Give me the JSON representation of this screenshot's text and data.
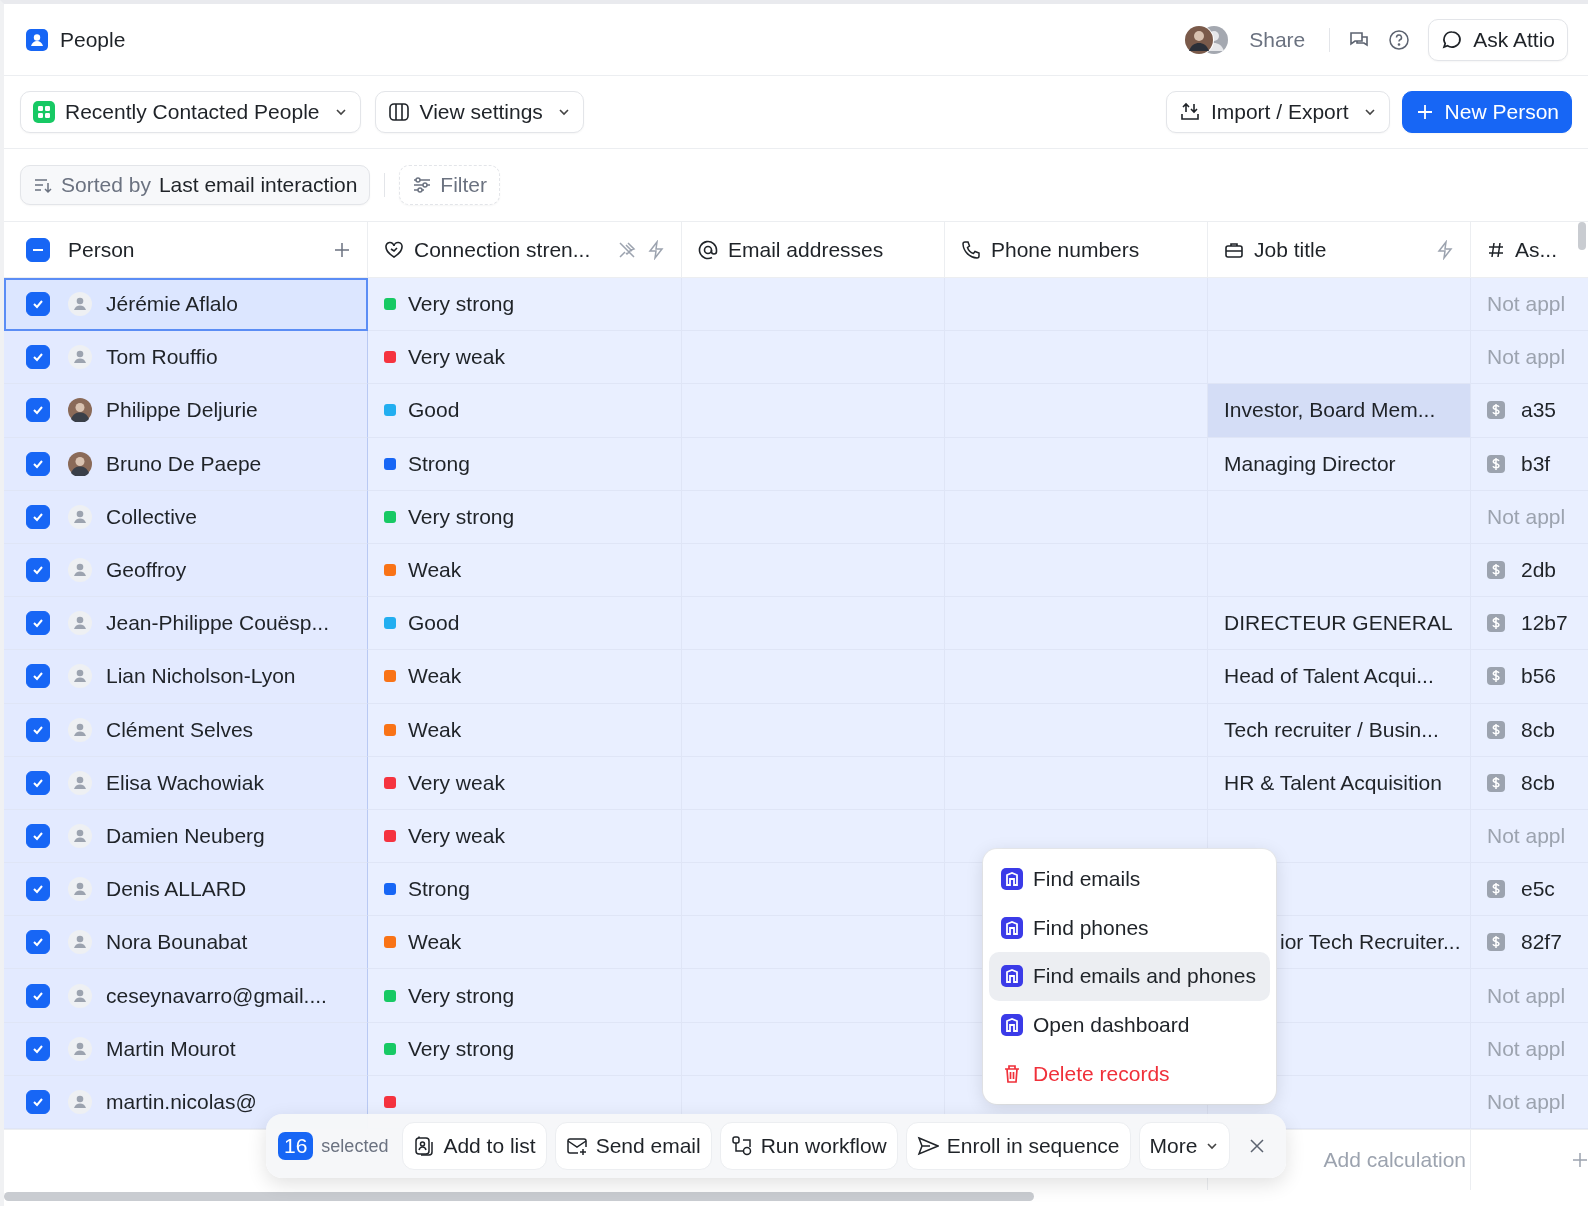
{
  "header": {
    "title": "People",
    "share": "Share",
    "ask": "Ask Attio"
  },
  "toolbar": {
    "view": "Recently Contacted People",
    "view_settings": "View settings",
    "import_export": "Import / Export",
    "new": "New Person"
  },
  "sort": {
    "label": "Sorted by",
    "value": "Last email interaction",
    "filter": "Filter"
  },
  "table": {
    "select_all": {
      "indeterminate": true
    },
    "columns": [
      {
        "label": "Person"
      },
      {
        "label": "Connection stren..."
      },
      {
        "label": "Email addresses"
      },
      {
        "label": "Phone numbers"
      },
      {
        "label": "Job title"
      },
      {
        "label": "As..."
      }
    ],
    "rows": [
      {
        "name": "Jérémie Aflalo",
        "photo": false,
        "checked": true,
        "focused": true,
        "strength": "Very strong",
        "color": "#17c964",
        "job_hover": false,
        "last": {
          "kind": "none",
          "text": "Not appl"
        }
      },
      {
        "name": "Tom Rouffio",
        "photo": false,
        "checked": true,
        "focused": false,
        "strength": "Very weak",
        "color": "#f5333f",
        "job_hover": false,
        "last": {
          "kind": "none",
          "text": "Not appl"
        }
      },
      {
        "name": "Philippe Deljurie",
        "photo": true,
        "checked": true,
        "focused": false,
        "strength": "Good",
        "color": "#22aef0",
        "job": "Investor, Board Mem...",
        "job_hover": true,
        "last": {
          "kind": "id",
          "text": "a35"
        }
      },
      {
        "name": "Bruno De Paepe",
        "photo": true,
        "checked": true,
        "focused": false,
        "strength": "Strong",
        "color": "#1766f5",
        "job": "Managing Director",
        "job_hover": false,
        "last": {
          "kind": "id",
          "text": "b3f"
        }
      },
      {
        "name": "Collective",
        "photo": false,
        "checked": true,
        "focused": false,
        "strength": "Very strong",
        "color": "#17c964",
        "job_hover": false,
        "last": {
          "kind": "none",
          "text": "Not appl"
        }
      },
      {
        "name": "Geoffroy",
        "photo": false,
        "checked": true,
        "focused": false,
        "strength": "Weak",
        "color": "#f97316",
        "job_hover": false,
        "last": {
          "kind": "id",
          "text": "2db"
        }
      },
      {
        "name": "Jean-Philippe Couësp...",
        "photo": false,
        "checked": true,
        "focused": false,
        "strength": "Good",
        "color": "#22aef0",
        "job": "DIRECTEUR GENERAL",
        "job_hover": false,
        "last": {
          "kind": "id",
          "text": "12b7"
        }
      },
      {
        "name": "Lian Nicholson-Lyon",
        "photo": false,
        "checked": true,
        "focused": false,
        "strength": "Weak",
        "color": "#f97316",
        "job": "Head of Talent Acqui...",
        "job_hover": false,
        "last": {
          "kind": "id",
          "text": "b56"
        }
      },
      {
        "name": "Clément Selves",
        "photo": false,
        "checked": true,
        "focused": false,
        "strength": "Weak",
        "color": "#f97316",
        "job": "Tech recruiter / Busin...",
        "job_hover": false,
        "last": {
          "kind": "id",
          "text": "8cb"
        }
      },
      {
        "name": "Elisa Wachowiak",
        "photo": false,
        "checked": true,
        "focused": false,
        "strength": "Very weak",
        "color": "#f5333f",
        "job": "HR & Talent Acquisition",
        "job_hover": false,
        "last": {
          "kind": "id",
          "text": "8cb"
        }
      },
      {
        "name": "Damien Neuberg",
        "photo": false,
        "checked": true,
        "focused": false,
        "strength": "Very weak",
        "color": "#f5333f",
        "job_hover": false,
        "last": {
          "kind": "none",
          "text": "Not appl"
        }
      },
      {
        "name": "Denis ALLARD",
        "photo": false,
        "checked": true,
        "focused": false,
        "strength": "Strong",
        "color": "#1766f5",
        "job_hover": false,
        "last": {
          "kind": "id",
          "text": "e5c"
        }
      },
      {
        "name": "Nora Bounabat",
        "photo": false,
        "checked": true,
        "focused": false,
        "strength": "Weak",
        "color": "#f97316",
        "job": "ior Tech Recruiter...",
        "job_hover": false,
        "job_covered": true,
        "last": {
          "kind": "id",
          "text": "82f7"
        }
      },
      {
        "name": "ceseynavarro@gmail....",
        "photo": false,
        "checked": true,
        "focused": false,
        "strength": "Very strong",
        "color": "#17c964",
        "job_hover": false,
        "last": {
          "kind": "none",
          "text": "Not appl"
        }
      },
      {
        "name": "Martin Mourot",
        "photo": false,
        "checked": true,
        "focused": false,
        "strength": "Very strong",
        "color": "#17c964",
        "job_hover": false,
        "last": {
          "kind": "none",
          "text": "Not appl"
        }
      },
      {
        "name": "martin.nicolas@",
        "photo": false,
        "checked": true,
        "focused": false,
        "color": "#f5333f",
        "job_hover": false,
        "last": {
          "kind": "none",
          "text": "Not appl"
        }
      }
    ],
    "footer": {
      "job": "Add calculation"
    }
  },
  "menu": [
    {
      "label": "Find emails",
      "kind": "app",
      "highlighted": false
    },
    {
      "label": "Find phones",
      "kind": "app",
      "highlighted": false
    },
    {
      "label": "Find emails and phones",
      "kind": "app",
      "highlighted": true
    },
    {
      "label": "Open dashboard",
      "kind": "app",
      "highlighted": false
    },
    {
      "label": "Delete records",
      "kind": "danger",
      "highlighted": false
    }
  ],
  "action_bar": {
    "count": "16",
    "selected": "selected",
    "buttons": [
      {
        "label": "Add to list",
        "kind": "list"
      },
      {
        "label": "Send email",
        "kind": "email"
      },
      {
        "label": "Run workflow",
        "kind": "workflow"
      },
      {
        "label": "Enroll in sequence",
        "kind": "sequence"
      },
      {
        "label": "More",
        "kind": "more"
      }
    ]
  }
}
